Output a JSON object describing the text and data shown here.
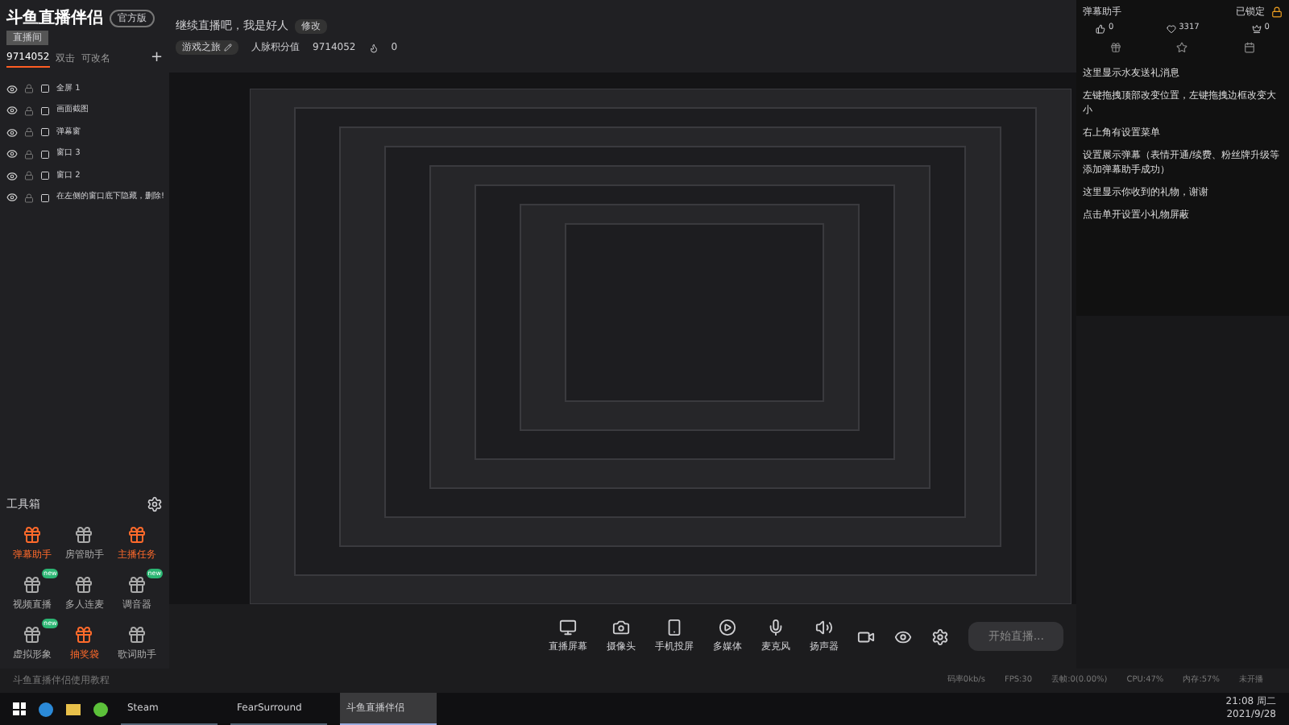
{
  "app": {
    "logo": "斗鱼直播伴侣",
    "version": "官方版",
    "room_tag": "直播间"
  },
  "scene_tabs": [
    {
      "label": "9714052",
      "selected": true
    },
    {
      "label": "双击",
      "selected": false
    },
    {
      "label": "可改名",
      "selected": false
    }
  ],
  "add_scene": "+",
  "sources": [
    {
      "name": "全屏 1",
      "visible": true
    },
    {
      "name": "画面截图",
      "visible": true
    },
    {
      "name": "弹幕窗",
      "visible": true
    },
    {
      "name": "窗口 3",
      "visible": true
    },
    {
      "name": "窗口 2",
      "visible": true
    },
    {
      "name": "在左侧的窗口底下隐藏，删除!",
      "visible": true
    }
  ],
  "stream_info": {
    "title": "继续直播吧，我是好人",
    "edit": "修改",
    "category": "游戏之旅",
    "fans_label": "人脉积分值",
    "room_id": "9714052",
    "hot": "0"
  },
  "toolbox": {
    "title": "工具箱",
    "tools": [
      {
        "label": "弹幕助手",
        "active": true
      },
      {
        "label": "房管助手",
        "active": false
      },
      {
        "label": "主播任务",
        "active": true
      },
      {
        "label": "视频直播",
        "active": false,
        "badge": "new"
      },
      {
        "label": "多人连麦",
        "active": false
      },
      {
        "label": "调音器",
        "active": false,
        "badge": "new"
      },
      {
        "label": "虚拟形象",
        "active": false,
        "badge": "new"
      },
      {
        "label": "抽奖袋",
        "active": true
      },
      {
        "label": "歌词助手",
        "active": false
      }
    ]
  },
  "tutorial": "斗鱼直播伴侣使用教程",
  "controls": [
    {
      "label": "直播屏幕",
      "kind": "screen"
    },
    {
      "label": "摄像头",
      "kind": "camera"
    },
    {
      "label": "手机投屏",
      "kind": "phone"
    },
    {
      "label": "多媒体",
      "kind": "media"
    },
    {
      "label": "麦克风",
      "kind": "mic"
    },
    {
      "label": "扬声器",
      "kind": "speaker"
    }
  ],
  "start_button": "开始直播...",
  "status": [
    "码率0kb/s",
    "FPS:30",
    "丢帧:0(0.00%)",
    "CPU:47%",
    "内存:57%",
    "未开播"
  ],
  "chat": {
    "title": "弹幕助手",
    "lock": "已锁定",
    "likes": "0",
    "gifts": "3317",
    "nobles": "0",
    "messages": [
      "这里显示水友送礼消息",
      "左键拖拽顶部改变位置，左键拖拽边框改变大小",
      "右上角有设置菜单",
      "设置展示弹幕（表情开通/续费、粉丝牌升级等添加弹幕助手成功）",
      "这里显示你收到的礼物，谢谢",
      "点击单开设置小礼物屏蔽"
    ]
  },
  "taskbar": {
    "apps": [
      {
        "label": "Steam",
        "selected": false
      },
      {
        "label": "FearSurround",
        "selected": false
      },
      {
        "label": "斗鱼直播伴侣",
        "selected": true
      }
    ],
    "time": "21:08 周二",
    "date": "2021/9/28"
  }
}
